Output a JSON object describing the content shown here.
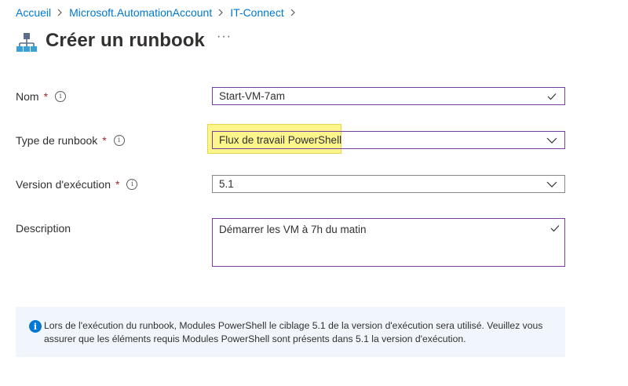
{
  "breadcrumb": {
    "items": [
      "Accueil",
      "Microsoft.AutomationAccount",
      "IT-Connect"
    ]
  },
  "page": {
    "title": "Créer un runbook",
    "more": "···"
  },
  "form": {
    "name": {
      "label": "Nom",
      "required": "*",
      "value": "Start-VM-7am"
    },
    "type": {
      "label": "Type de runbook",
      "required": "*",
      "value": "Flux de travail PowerShell"
    },
    "version": {
      "label": "Version d'exécution",
      "required": "*",
      "value": "5.1"
    },
    "description": {
      "label": "Description",
      "value": "Démarrer les VM à 7h du matin"
    }
  },
  "info": {
    "line1": "Lors de l'exécution du runbook, Modules PowerShell le ciblage 5.1 de la version d'exécution sera utilisé. Veuillez vous",
    "line2": "assurer que les éléments requis Modules PowerShell sont présents dans 5.1 la version d'exécution."
  },
  "colors": {
    "link": "#0078d4",
    "valid_border": "#7a3e9d",
    "highlight": "#fbf58c",
    "info_bg": "#f0f6fc"
  }
}
